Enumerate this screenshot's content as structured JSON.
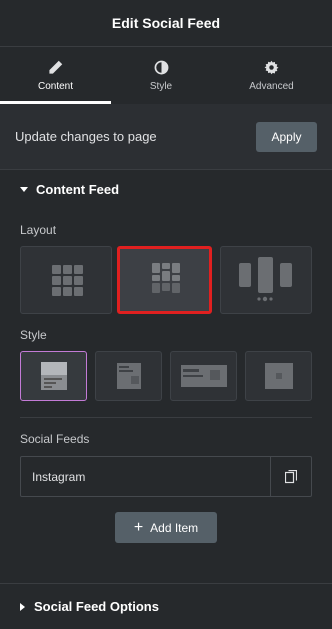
{
  "header": {
    "title": "Edit Social Feed"
  },
  "tabs": [
    {
      "label": "Content",
      "icon": "pencil-icon",
      "active": true
    },
    {
      "label": "Style",
      "icon": "contrast-icon",
      "active": false
    },
    {
      "label": "Advanced",
      "icon": "gear-icon",
      "active": false
    }
  ],
  "update_panel": {
    "text": "Update changes to page",
    "apply_label": "Apply"
  },
  "content_feed": {
    "title": "Content Feed",
    "layout_label": "Layout",
    "layout_options": [
      "grid-layout",
      "masonry-layout",
      "carousel-layout"
    ],
    "layout_selected": 1,
    "style_label": "Style",
    "style_options": [
      "style-1",
      "style-2",
      "style-3",
      "style-4"
    ],
    "style_selected": 0,
    "social_feeds_label": "Social Feeds",
    "feeds": [
      {
        "name": "Instagram"
      }
    ],
    "add_item_label": "Add Item"
  },
  "social_feed_options": {
    "title": "Social Feed Options"
  },
  "colors": {
    "background": "#26292c",
    "selection_red": "#e02020",
    "selection_purple": "#c37bd6",
    "button": "#556068"
  }
}
